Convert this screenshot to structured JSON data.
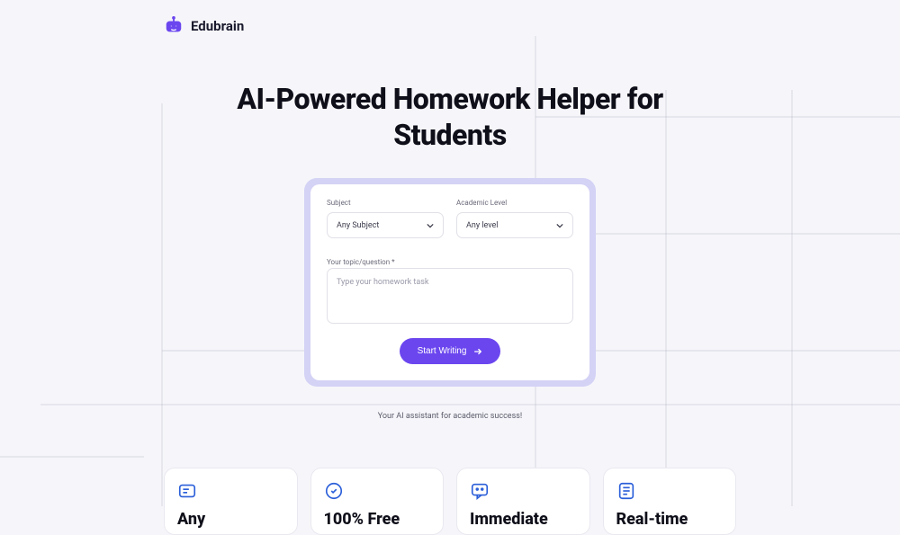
{
  "header": {
    "brand": "Edubrain"
  },
  "hero": {
    "title_line1": "AI-Powered Homework Helper for",
    "title_line2": "Students"
  },
  "form": {
    "subject_label": "Subject",
    "subject_value": "Any Subject",
    "level_label": "Academic Level",
    "level_value": "Any level",
    "topic_label": "Your topic/question *",
    "topic_placeholder": "Type your homework task",
    "submit_label": "Start Writing"
  },
  "subtitle": "Your AI assistant for academic success!",
  "features": [
    {
      "title": "Any"
    },
    {
      "title": "100% Free"
    },
    {
      "title": "Immediate"
    },
    {
      "title": "Real-time"
    }
  ]
}
